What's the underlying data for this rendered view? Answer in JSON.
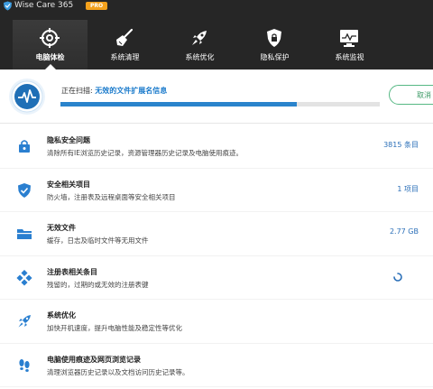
{
  "window": {
    "title": "Wise Care 365",
    "badge": "PRO"
  },
  "nav": {
    "items": [
      {
        "label": "电脑体检",
        "icon": "crosshair-icon",
        "active": true
      },
      {
        "label": "系统清理",
        "icon": "broom-icon",
        "active": false
      },
      {
        "label": "系统优化",
        "icon": "rocket-icon",
        "active": false
      },
      {
        "label": "隐私保护",
        "icon": "shield-lock-icon",
        "active": false
      },
      {
        "label": "系统监视",
        "icon": "monitor-icon",
        "active": false
      }
    ]
  },
  "scan": {
    "prefix": "正在扫描:",
    "current": "无效的文件扩展名信息",
    "progress": 0.74,
    "cancel_label": "取消"
  },
  "items": [
    {
      "title": "隐私安全问题",
      "desc": "清除所有IE浏览历史记录，资源管理器历史记录及电脑使用痕迹。",
      "value": "3815 条目",
      "icon": "privacy-lock-icon"
    },
    {
      "title": "安全相关项目",
      "desc": "防火墙，注册表及远程桌面等安全相关项目",
      "value": "1 项目",
      "icon": "security-shield-icon"
    },
    {
      "title": "无效文件",
      "desc": "缓存，日志及临时文件等无用文件",
      "value": "2.77 GB",
      "icon": "folder-icon"
    },
    {
      "title": "注册表相关条目",
      "desc": "残留的，过期的或无效的注册表键",
      "value": "",
      "icon": "registry-cubes-icon"
    },
    {
      "title": "系统优化",
      "desc": "加快开机速度，提升电脑性能及稳定性等优化",
      "value": "",
      "icon": "rocket-icon"
    },
    {
      "title": "电脑使用痕迹及网页浏览记录",
      "desc": "清理浏览器历史记录以及文档访问历史记录等。",
      "value": "",
      "icon": "footprints-icon"
    }
  ],
  "colors": {
    "accent": "#2a84cc",
    "header_bg": "#262626",
    "pro": "#f4a11c",
    "cancel": "#56b884"
  }
}
